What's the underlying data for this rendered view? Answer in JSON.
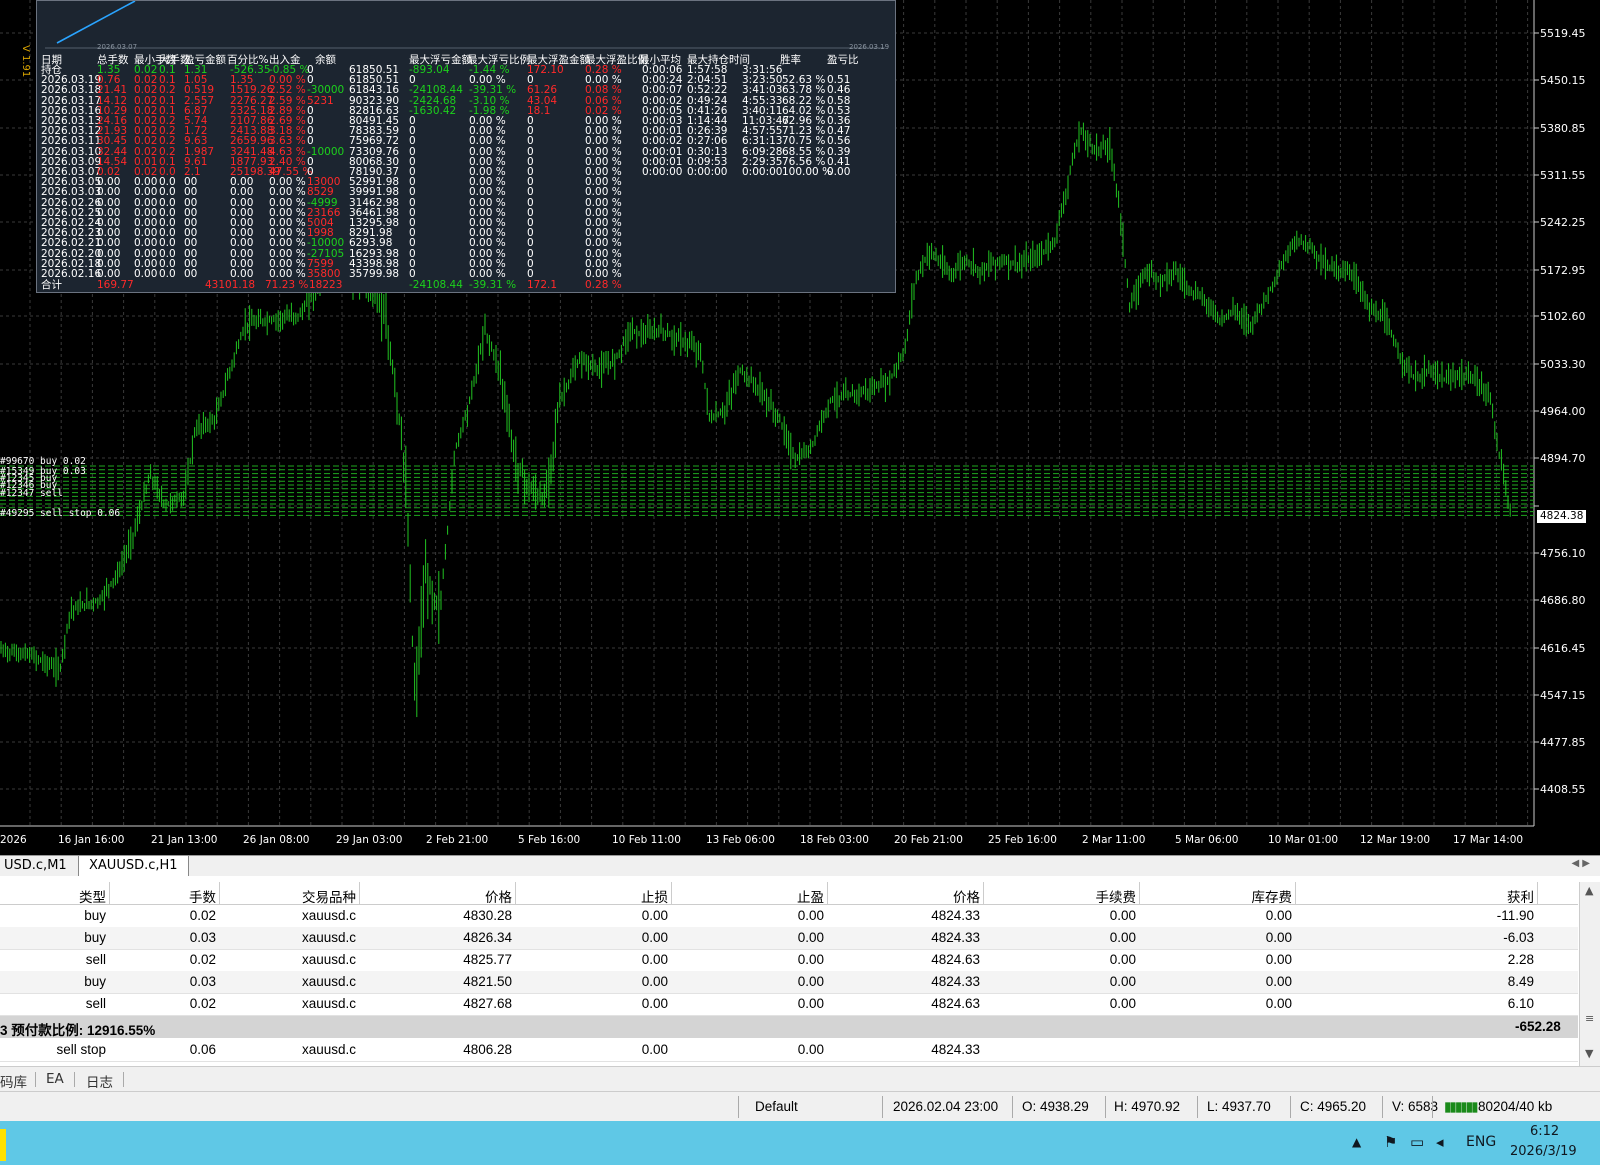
{
  "stats_panel": {
    "side_version": "V 1.91",
    "mini_dates": [
      "2026.03.07",
      "2026.03.19"
    ],
    "headers": [
      "日期",
      "总手数",
      "最小手数",
      "大手数",
      "盈亏金额",
      "百分比%",
      "出入金",
      "余额",
      "最大浮亏金额",
      "最大浮亏比例",
      "最大浮盈金额",
      "最大浮盈比例",
      "最小平均",
      "最大持仓时间",
      "胜率",
      "盈亏比"
    ],
    "rows": [
      {
        "d": "持仓",
        "c": [
          "1.35",
          "0.02",
          "0.1",
          "1.31",
          "-526.35",
          "-0.85 %",
          "0",
          "61850.51",
          "-893.04",
          "-1.44 %",
          "172.10",
          "0.28 %",
          "0:00:06",
          "1:57:58",
          "3:31:56",
          "",
          ""
        ],
        "k": [
          "green",
          "green",
          "green",
          "green",
          "green",
          "green",
          "white",
          "white",
          "green",
          "green",
          "red",
          "red",
          "white",
          "white",
          "white",
          "white",
          "white"
        ]
      },
      {
        "d": "2026.03.19",
        "c": [
          "0.76",
          "0.02",
          "0.1",
          "1.05",
          "1.35",
          "0.00 %",
          "0",
          "61850.51",
          "0",
          "0.00 %",
          "0",
          "0.00 %",
          "0:00:24",
          "2:04:51",
          "3:23:50",
          "52.63 %",
          "0.51"
        ],
        "k": [
          "red",
          "red",
          "red",
          "red",
          "red",
          "red",
          "white",
          "white",
          "white",
          "white",
          "white",
          "white",
          "white",
          "white",
          "white",
          "white",
          "white"
        ]
      },
      {
        "d": "2026.03.18",
        "c": [
          "21.41",
          "0.02",
          "0.2",
          "0.519",
          "1519.26",
          "2.52 %",
          "-30000",
          "61843.16",
          "-24108.44",
          "-39.31 %",
          "61.26",
          "0.08 %",
          "0:00:07",
          "0:52:22",
          "3:41:03",
          "63.78 %",
          "0.46"
        ],
        "k": [
          "red",
          "red",
          "red",
          "red",
          "red",
          "red",
          "green",
          "white",
          "green",
          "green",
          "red",
          "red",
          "white",
          "white",
          "white",
          "white",
          "white"
        ]
      },
      {
        "d": "2026.03.17",
        "c": [
          "14.12",
          "0.02",
          "0.1",
          "2.557",
          "2276.27",
          "2.59 %",
          "5231",
          "90323.90",
          "-2424.68",
          "-3.10 %",
          "43.04",
          "0.06 %",
          "0:00:02",
          "0:49:24",
          "4:55:33",
          "68.22 %",
          "0.58"
        ],
        "k": [
          "red",
          "red",
          "red",
          "red",
          "red",
          "red",
          "red",
          "white",
          "green",
          "green",
          "red",
          "red",
          "white",
          "white",
          "white",
          "white",
          "white"
        ]
      },
      {
        "d": "2026.03.16",
        "c": [
          "10.29",
          "0.02",
          "0.1",
          "6.87",
          "2325.18",
          "2.89 %",
          "0",
          "82816.63",
          "-1630.42",
          "-1.98 %",
          "18.1",
          "0.02 %",
          "0:00:05",
          "0:41:26",
          "3:40:11",
          "64.02 %",
          "0.53"
        ],
        "k": [
          "red",
          "red",
          "red",
          "red",
          "red",
          "red",
          "white",
          "white",
          "green",
          "green",
          "red",
          "red",
          "white",
          "white",
          "white",
          "white",
          "white"
        ]
      },
      {
        "d": "2026.03.13",
        "c": [
          "24.16",
          "0.02",
          "0.2",
          "5.74",
          "2107.86",
          "2.69 %",
          "0",
          "80491.45",
          "0",
          "0.00 %",
          "0",
          "0.00 %",
          "0:00:03",
          "1:14:44",
          "11:03:47",
          "62.96 %",
          "0.36"
        ],
        "k": [
          "red",
          "red",
          "red",
          "red",
          "red",
          "red",
          "white",
          "white",
          "white",
          "white",
          "white",
          "white",
          "white",
          "white",
          "white",
          "white",
          "white"
        ]
      },
      {
        "d": "2026.03.12",
        "c": [
          "21.93",
          "0.02",
          "0.2",
          "1.72",
          "2413.88",
          "3.18 %",
          "0",
          "78383.59",
          "0",
          "0.00 %",
          "0",
          "0.00 %",
          "0:00:01",
          "0:26:39",
          "4:57:55",
          "71.23 %",
          "0.47"
        ],
        "k": [
          "red",
          "red",
          "red",
          "red",
          "red",
          "red",
          "white",
          "white",
          "white",
          "white",
          "white",
          "white",
          "white",
          "white",
          "white",
          "white",
          "white"
        ]
      },
      {
        "d": "2026.03.11",
        "c": [
          "30.45",
          "0.02",
          "0.2",
          "9.63",
          "2659.96",
          "3.63 %",
          "0",
          "75969.72",
          "0",
          "0.00 %",
          "0",
          "0.00 %",
          "0:00:02",
          "0:27:06",
          "6:31:13",
          "70.75 %",
          "0.56"
        ],
        "k": [
          "red",
          "red",
          "red",
          "red",
          "red",
          "red",
          "white",
          "white",
          "white",
          "white",
          "white",
          "white",
          "white",
          "white",
          "white",
          "white",
          "white"
        ]
      },
      {
        "d": "2026.03.10",
        "c": [
          "32.44",
          "0.02",
          "0.2",
          "1.987",
          "3241.48",
          "4.63 %",
          "-10000",
          "73309.76",
          "0",
          "0.00 %",
          "0",
          "0.00 %",
          "0:00:01",
          "0:30:13",
          "6:09:28",
          "68.55 %",
          "0.39"
        ],
        "k": [
          "red",
          "red",
          "red",
          "red",
          "red",
          "red",
          "green",
          "white",
          "white",
          "white",
          "white",
          "white",
          "white",
          "white",
          "white",
          "white",
          "white"
        ]
      },
      {
        "d": "2026.03.09",
        "c": [
          "14.54",
          "0.01",
          "0.1",
          "9.61",
          "1877.93",
          "2.40 %",
          "0",
          "80068.30",
          "0",
          "0.00 %",
          "0",
          "0.00 %",
          "0:00:01",
          "0:09:53",
          "2:29:35",
          "76.56 %",
          "0.41"
        ],
        "k": [
          "red",
          "red",
          "red",
          "red",
          "red",
          "red",
          "white",
          "white",
          "white",
          "white",
          "white",
          "white",
          "white",
          "white",
          "white",
          "white",
          "white"
        ]
      },
      {
        "d": "2026.03.07",
        "c": [
          "0.02",
          "0.02",
          "0.0",
          "2.1",
          "25198.39",
          "47.55 %",
          "0",
          "78190.37",
          "0",
          "0.00 %",
          "0",
          "0.00 %",
          "0:00:00",
          "0:00:00",
          "0:00:00",
          "100.00 %",
          "0.00"
        ],
        "k": [
          "red",
          "red",
          "red",
          "red",
          "red",
          "red",
          "white",
          "white",
          "white",
          "white",
          "white",
          "white",
          "white",
          "white",
          "white",
          "white",
          "white"
        ]
      },
      {
        "d": "2026.03.05",
        "c": [
          "0.00",
          "0.00",
          "0.0",
          "00",
          "0.00",
          "0.00 %",
          "13000",
          "52991.98",
          "0",
          "0.00 %",
          "0",
          "0.00 %",
          "",
          "",
          "",
          "",
          ""
        ],
        "k": [
          "white",
          "white",
          "white",
          "white",
          "white",
          "white",
          "red",
          "white",
          "white",
          "white",
          "white",
          "white",
          "white",
          "white",
          "white",
          "white",
          "white"
        ]
      },
      {
        "d": "2026.03.03",
        "c": [
          "0.00",
          "0.00",
          "0.0",
          "00",
          "0.00",
          "0.00 %",
          "8529",
          "39991.98",
          "0",
          "0.00 %",
          "0",
          "0.00 %",
          "",
          "",
          "",
          "",
          ""
        ],
        "k": [
          "white",
          "white",
          "white",
          "white",
          "white",
          "white",
          "red",
          "white",
          "white",
          "white",
          "white",
          "white",
          "white",
          "white",
          "white",
          "white",
          "white"
        ]
      },
      {
        "d": "2026.02.26",
        "c": [
          "0.00",
          "0.00",
          "0.0",
          "00",
          "0.00",
          "0.00 %",
          "-4999",
          "31462.98",
          "0",
          "0.00 %",
          "0",
          "0.00 %",
          "",
          "",
          "",
          "",
          ""
        ],
        "k": [
          "white",
          "white",
          "white",
          "white",
          "white",
          "white",
          "green",
          "white",
          "white",
          "white",
          "white",
          "white",
          "white",
          "white",
          "white",
          "white",
          "white"
        ]
      },
      {
        "d": "2026.02.25",
        "c": [
          "0.00",
          "0.00",
          "0.0",
          "00",
          "0.00",
          "0.00 %",
          "23166",
          "36461.98",
          "0",
          "0.00 %",
          "0",
          "0.00 %",
          "",
          "",
          "",
          "",
          ""
        ],
        "k": [
          "white",
          "white",
          "white",
          "white",
          "white",
          "white",
          "red",
          "white",
          "white",
          "white",
          "white",
          "white",
          "white",
          "white",
          "white",
          "white",
          "white"
        ]
      },
      {
        "d": "2026.02.24",
        "c": [
          "0.00",
          "0.00",
          "0.0",
          "00",
          "0.00",
          "0.00 %",
          "5004",
          "13295.98",
          "0",
          "0.00 %",
          "0",
          "0.00 %",
          "",
          "",
          "",
          "",
          ""
        ],
        "k": [
          "white",
          "white",
          "white",
          "white",
          "white",
          "white",
          "red",
          "white",
          "white",
          "white",
          "white",
          "white",
          "white",
          "white",
          "white",
          "white",
          "white"
        ]
      },
      {
        "d": "2026.02.23",
        "c": [
          "0.00",
          "0.00",
          "0.0",
          "00",
          "0.00",
          "0.00 %",
          "1998",
          "8291.98",
          "0",
          "0.00 %",
          "0",
          "0.00 %",
          "",
          "",
          "",
          "",
          ""
        ],
        "k": [
          "white",
          "white",
          "white",
          "white",
          "white",
          "white",
          "red",
          "white",
          "white",
          "white",
          "white",
          "white",
          "white",
          "white",
          "white",
          "white",
          "white"
        ]
      },
      {
        "d": "2026.02.21",
        "c": [
          "0.00",
          "0.00",
          "0.0",
          "00",
          "0.00",
          "0.00 %",
          "-10000",
          "6293.98",
          "0",
          "0.00 %",
          "0",
          "0.00 %",
          "",
          "",
          "",
          "",
          ""
        ],
        "k": [
          "white",
          "white",
          "white",
          "white",
          "white",
          "white",
          "green",
          "white",
          "white",
          "white",
          "white",
          "white",
          "white",
          "white",
          "white",
          "white",
          "white"
        ]
      },
      {
        "d": "2026.02.20",
        "c": [
          "0.00",
          "0.00",
          "0.0",
          "00",
          "0.00",
          "0.00 %",
          "-27105",
          "16293.98",
          "0",
          "0.00 %",
          "0",
          "0.00 %",
          "",
          "",
          "",
          "",
          ""
        ],
        "k": [
          "white",
          "white",
          "white",
          "white",
          "white",
          "white",
          "green",
          "white",
          "white",
          "white",
          "white",
          "white",
          "white",
          "white",
          "white",
          "white",
          "white"
        ]
      },
      {
        "d": "2026.02.18",
        "c": [
          "0.00",
          "0.00",
          "0.0",
          "00",
          "0.00",
          "0.00 %",
          "7599",
          "43398.98",
          "0",
          "0.00 %",
          "0",
          "0.00 %",
          "",
          "",
          "",
          "",
          ""
        ],
        "k": [
          "white",
          "white",
          "white",
          "white",
          "white",
          "white",
          "red",
          "white",
          "white",
          "white",
          "white",
          "white",
          "white",
          "white",
          "white",
          "white",
          "white"
        ]
      },
      {
        "d": "2026.02.16",
        "c": [
          "0.00",
          "0.00",
          "0.0",
          "00",
          "0.00",
          "0.00 %",
          "35800",
          "35799.98",
          "0",
          "0.00 %",
          "0",
          "0.00 %",
          "",
          "",
          "",
          "",
          ""
        ],
        "k": [
          "white",
          "white",
          "white",
          "white",
          "white",
          "white",
          "red",
          "white",
          "white",
          "white",
          "white",
          "white",
          "white",
          "white",
          "white",
          "white",
          "white"
        ]
      }
    ],
    "total": {
      "label": "合计",
      "lots": "169.77",
      "pnl": "43101.18",
      "pct": "71.23 %",
      "flow": "18223",
      "max_dd": "-24108.44",
      "max_dd_pct": "-39.31 %",
      "max_fp": "172.1",
      "max_fp_pct": "0.28 %"
    }
  },
  "chart": {
    "price_labels": [
      "5519.45",
      "5450.15",
      "5380.85",
      "5311.55",
      "5242.25",
      "5172.95",
      "5102.60",
      "5033.30",
      "4964.00",
      "4894.70",
      "4824.38",
      "4756.10",
      "4686.80",
      "4616.45",
      "4547.15",
      "4477.85",
      "4408.55"
    ],
    "current_price": "4824.38",
    "time_labels": [
      "2026",
      "16 Jan 16:00",
      "21 Jan 13:00",
      "26 Jan 08:00",
      "29 Jan 03:00",
      "2 Feb 21:00",
      "5 Feb 16:00",
      "10 Feb 11:00",
      "13 Feb 06:00",
      "18 Feb 03:00",
      "20 Feb 21:00",
      "25 Feb 16:00",
      "2 Mar 11:00",
      "5 Mar 06:00",
      "10 Mar 01:00",
      "12 Mar 19:00",
      "17 Mar 14:00"
    ],
    "order_tags": [
      "#99670 buy 0.02",
      "#15349 buy 0.03",
      "#12345 buy",
      "#12346 buy",
      "#12347 sell",
      "#49295 sell stop 0.06"
    ],
    "colors": {
      "candle": "#21c321",
      "grid": "#3a3a3a",
      "orders": "#1fa81f"
    }
  },
  "tabs": {
    "inactive": "USD.c,M1",
    "active": "XAUUSD.c,H1",
    "nav": "◀  ▶"
  },
  "terminal": {
    "headers": [
      "类型",
      "手数",
      "交易品种",
      "价格",
      "止损",
      "止盈",
      "价格",
      "手续费",
      "库存费",
      "获利"
    ],
    "rows": [
      [
        "buy",
        "0.02",
        "xauusd.c",
        "4830.28",
        "0.00",
        "0.00",
        "4824.33",
        "0.00",
        "0.00",
        "-11.90"
      ],
      [
        "buy",
        "0.03",
        "xauusd.c",
        "4826.34",
        "0.00",
        "0.00",
        "4824.33",
        "0.00",
        "0.00",
        "-6.03"
      ],
      [
        "sell",
        "0.02",
        "xauusd.c",
        "4825.77",
        "0.00",
        "0.00",
        "4824.63",
        "0.00",
        "0.00",
        "2.28"
      ],
      [
        "buy",
        "0.03",
        "xauusd.c",
        "4821.50",
        "0.00",
        "0.00",
        "4824.33",
        "0.00",
        "0.00",
        "8.49"
      ],
      [
        "sell",
        "0.02",
        "xauusd.c",
        "4827.68",
        "0.00",
        "0.00",
        "4824.63",
        "0.00",
        "0.00",
        "6.10"
      ]
    ],
    "summary": {
      "label": "3  预付款比例: 12916.55%",
      "profit": "-652.28"
    },
    "pending": [
      "sell stop",
      "0.06",
      "xauusd.c",
      "4806.28",
      "0.00",
      "0.00",
      "4824.33",
      "",
      "",
      ""
    ]
  },
  "bottom_tabs": [
    "码库",
    "EA",
    "日志"
  ],
  "status": {
    "profile": "Default",
    "time": "2026.02.04 23:00",
    "open": "O: 4938.29",
    "high": "H: 4970.92",
    "low": "L: 4937.70",
    "close": "C: 4965.20",
    "volume": "V: 6583",
    "traffic": "80204/40 kb"
  },
  "taskbar": {
    "lang": "ENG",
    "time": "6:12",
    "date": "2026/3/19"
  }
}
